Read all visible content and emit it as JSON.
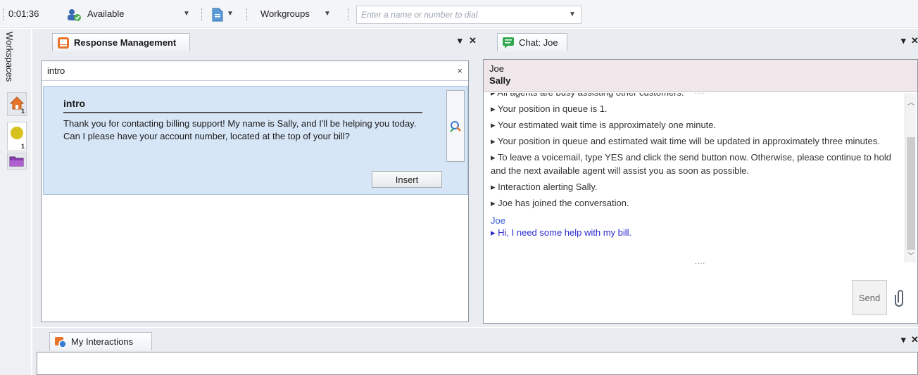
{
  "toolbar": {
    "timer": "0:01:36",
    "status": "Available",
    "workgroups_label": "Workgroups",
    "dial_placeholder": "Enter a name or number to dial"
  },
  "rail": {
    "label": "Workspaces",
    "badges": [
      "1",
      "1"
    ]
  },
  "response_management": {
    "tab_label": "Response Management",
    "search_value": "intro",
    "clear_glyph": "×",
    "item": {
      "title": "intro",
      "text": "Thank you for contacting billing support! My name is Sally, and I'll be helping you today. Can I please have your account number, located at the top of your bill?",
      "insert_label": "Insert"
    }
  },
  "chat": {
    "tab_label": "Chat: Joe",
    "participants": [
      "Joe",
      "Sally"
    ],
    "messages": [
      "▸ All agents are busy assisting other customers.",
      "▸ Your position in queue is 1.",
      "▸ Your estimated wait time is approximately one minute.",
      "▸ Your position in queue and estimated wait time will be updated in approximately three minutes.",
      "▸ To leave a voicemail, type YES and click the send button now.  Otherwise, please continue to hold and the next available agent will assist you as soon as possible.",
      "▸ Interaction alerting Sally.",
      "▸ Joe has joined the conversation."
    ],
    "user_sender": "Joe",
    "user_message": "▸ Hi, I need some help with my bill.",
    "send_label": "Send"
  },
  "my_interactions": {
    "tab_label": "My Interactions"
  },
  "panel_controls": {
    "pin": "▾",
    "close": "✕"
  },
  "colors": {
    "accent_orange": "#e8742a",
    "chat_green": "#2fa84f",
    "status_yellow": "#d7c21d"
  }
}
